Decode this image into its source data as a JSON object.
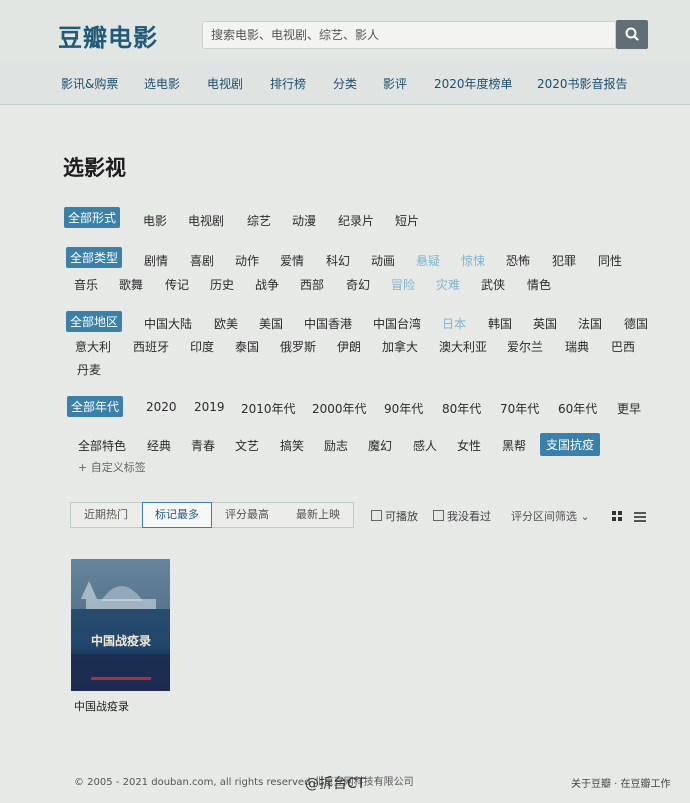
{
  "header": {
    "logo": "豆瓣电影",
    "search_placeholder": "搜索电影、电视剧、综艺、影人"
  },
  "nav": [
    "影讯&购票",
    "选电影",
    "电视剧",
    "排行榜",
    "分类",
    "影评",
    "2020年度榜单",
    "2020书影音报告"
  ],
  "page_title": "选影视",
  "filters": {
    "form": {
      "selected": "全部形式",
      "items": [
        "电影",
        "电视剧",
        "综艺",
        "动漫",
        "纪录片",
        "短片"
      ]
    },
    "type": {
      "selected": "全部类型",
      "items": [
        "剧情",
        "喜剧",
        "动作",
        "爱情",
        "科幻",
        "动画",
        "悬疑",
        "惊悚",
        "恐怖",
        "犯罪",
        "同性",
        "音乐",
        "歌舞",
        "传记",
        "历史",
        "战争",
        "西部",
        "奇幻",
        "冒险",
        "灾难",
        "武侠",
        "情色"
      ]
    },
    "region": {
      "selected": "全部地区",
      "items": [
        "中国大陆",
        "欧美",
        "美国",
        "中国香港",
        "中国台湾",
        "日本",
        "韩国",
        "英国",
        "法国",
        "德国",
        "意大利",
        "西班牙",
        "印度",
        "泰国",
        "俄罗斯",
        "伊朗",
        "加拿大",
        "澳大利亚",
        "爱尔兰",
        "瑞典",
        "巴西",
        "丹麦"
      ]
    },
    "year": {
      "selected": "全部年代",
      "items": [
        "2020",
        "2019",
        "2010年代",
        "2000年代",
        "90年代",
        "80年代",
        "70年代",
        "60年代",
        "更早"
      ]
    },
    "feature": {
      "items": [
        "全部特色",
        "经典",
        "青春",
        "文艺",
        "搞笑",
        "励志",
        "魔幻",
        "感人",
        "女性",
        "黑帮"
      ],
      "selected": "支国抗疫"
    },
    "custom_tag": "+ 自定义标签"
  },
  "sort": {
    "tabs": [
      "近期热门",
      "标记最多",
      "评分最高",
      "最新上映"
    ],
    "active_index": 1,
    "checkboxes": [
      "可播放",
      "我没看过"
    ],
    "range_filter": "评分区间筛选"
  },
  "movies": [
    {
      "title": "中国战疫录",
      "poster_text": "中国战疫录"
    }
  ],
  "footer": {
    "copyright": "© 2005 - 2021 douban.com, all rights reserved 北京豆网科技有限公司",
    "links": "关于豆瓣 · 在豆瓣工作",
    "watermark": "@拆台CT"
  }
}
